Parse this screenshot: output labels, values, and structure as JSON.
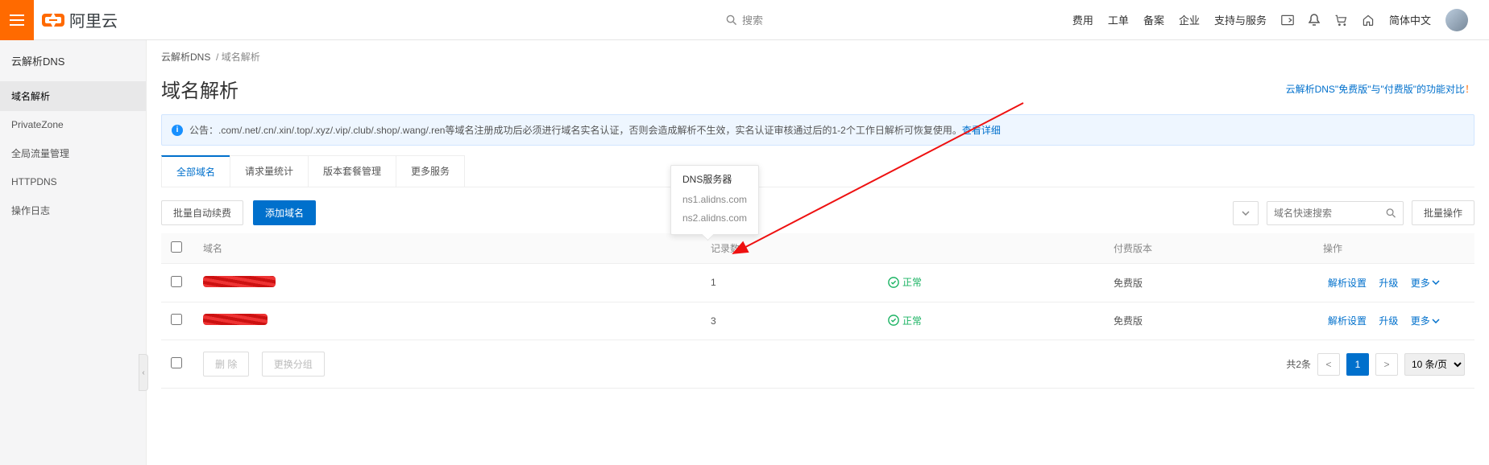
{
  "top": {
    "brand": "阿里云",
    "search_placeholder": "搜索",
    "nav": {
      "billing": "费用",
      "ticket": "工单",
      "icp": "备案",
      "enterprise": "企业",
      "support": "支持与服务",
      "lang": "简体中文"
    }
  },
  "sidebar": {
    "title": "云解析DNS",
    "items": [
      {
        "label": "域名解析"
      },
      {
        "label": "PrivateZone"
      },
      {
        "label": "全局流量管理"
      },
      {
        "label": "HTTPDNS"
      },
      {
        "label": "操作日志"
      }
    ]
  },
  "main": {
    "breadcrumb_root": "云解析DNS",
    "breadcrumb_current": "域名解析",
    "title": "域名解析",
    "compare_link": "云解析DNS\"免费版\"与\"付费版\"的功能对比",
    "compare_bang": "！",
    "notice_prefix": "公告：",
    "notice_text": ".com/.net/.cn/.xin/.top/.xyz/.vip/.club/.shop/.wang/.ren等域名注册成功后必须进行域名实名认证，否则会造成解析不生效，实名认证审核通过后的1-2个工作日解析可恢复使用。",
    "notice_link": "查看详细",
    "tabs": {
      "all": "全部域名",
      "req": "请求量统计",
      "ver": "版本套餐管理",
      "more": "更多服务"
    },
    "buttons": {
      "renew": "批量自动续费",
      "add": "添加域名",
      "bulk": "批量操作",
      "delete": "删 除",
      "regroup": "更换分组"
    },
    "search_placeholder": "域名快速搜索",
    "table": {
      "headers": {
        "domain": "域名",
        "records": "记录数",
        "plan": "付费版本",
        "ops": "操作"
      },
      "status_ok": "正常",
      "actions": {
        "resolve": "解析设置",
        "upgrade": "升级",
        "more": "更多"
      },
      "rows": [
        {
          "records": "1",
          "plan": "免费版"
        },
        {
          "records": "3",
          "plan": "免费版"
        }
      ]
    },
    "pagination": {
      "total": "共2条",
      "page": "1",
      "size": "10 条/页"
    }
  },
  "tooltip": {
    "title": "DNS服务器",
    "items": [
      "ns1.alidns.com",
      "ns2.alidns.com"
    ]
  }
}
